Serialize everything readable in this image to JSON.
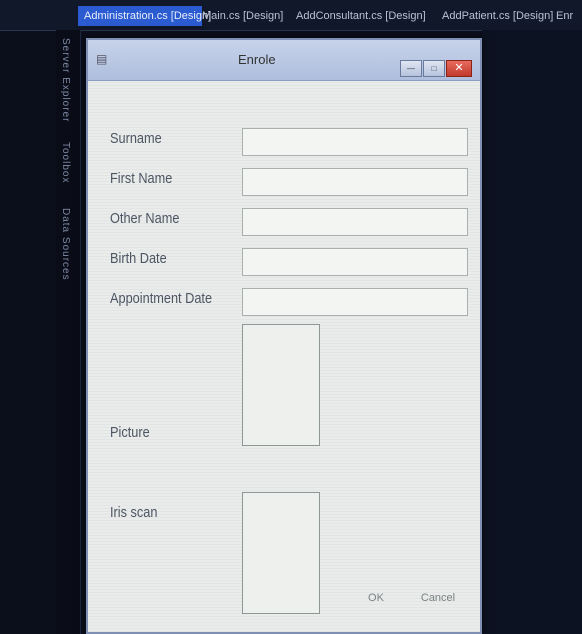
{
  "ide": {
    "tabs": [
      {
        "label": "Administration.cs [Design]"
      },
      {
        "label": "Main.cs [Design]"
      },
      {
        "label": "AddConsultant.cs [Design]"
      },
      {
        "label": "AddPatient.cs [Design]"
      },
      {
        "label": "Enr"
      }
    ],
    "side_panels": [
      "Server Explorer",
      "Toolbox",
      "Data Sources"
    ]
  },
  "window": {
    "title": "Enrole",
    "controls": {
      "minimize": "—",
      "maximize": "□",
      "close": "✕"
    },
    "icon": "form-icon"
  },
  "form": {
    "fields": [
      {
        "label": "Surname",
        "value": ""
      },
      {
        "label": "First Name",
        "value": ""
      },
      {
        "label": "Other Name",
        "value": ""
      },
      {
        "label": "Birth Date",
        "value": ""
      },
      {
        "label": "Appointment Date",
        "value": ""
      }
    ],
    "picture_label": "Picture",
    "scan_label": "Iris scan",
    "ok_label": "OK",
    "cancel_label": "Cancel"
  },
  "colors": {
    "ide_background": "#0b0f1c",
    "active_tab": "#2b5bd0",
    "titlebar": "#b6c5e2",
    "form_background": "#e9ecea",
    "close_button": "#c0392b"
  }
}
